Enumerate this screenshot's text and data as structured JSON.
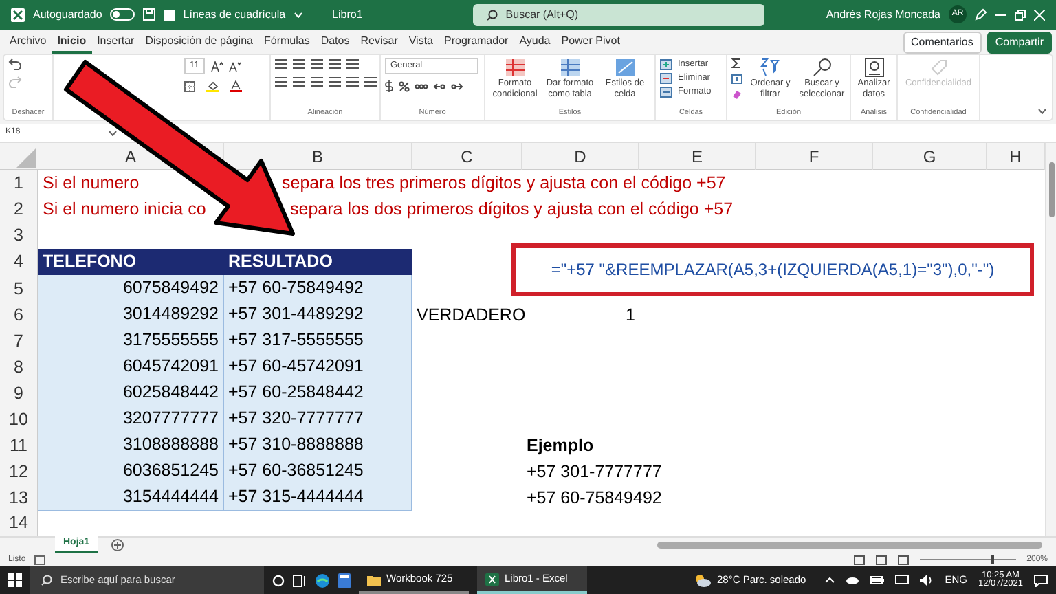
{
  "title_bar": {
    "autosave": {
      "label": "Autoguardado",
      "on": false
    },
    "gridlines": {
      "label": "Líneas de cuadrícula",
      "checked": false
    },
    "file_name": "Libro1",
    "search": {
      "placeholder": "Buscar (Alt+Q)"
    },
    "user": "Andrés Rojas Moncada",
    "avatar": "AR"
  },
  "tabs": [
    {
      "label": "Archivo",
      "selected": false
    },
    {
      "label": "Inicio",
      "selected": true
    },
    {
      "label": "Insertar",
      "selected": false
    },
    {
      "label": "Disposición de página",
      "selected": false
    },
    {
      "label": "Fórmulas",
      "selected": false
    },
    {
      "label": "Datos",
      "selected": false
    },
    {
      "label": "Revisar",
      "selected": false
    },
    {
      "label": "Vista",
      "selected": false
    },
    {
      "label": "Programador",
      "selected": false
    },
    {
      "label": "Ayuda",
      "selected": false
    },
    {
      "label": "Power Pivot",
      "selected": false
    }
  ],
  "tab_buttons": {
    "comments": "Comentarios",
    "share": "Compartir"
  },
  "ribbon": {
    "undo_label": "Deshacer",
    "font_size": "11",
    "alignment_label": "Alineación",
    "number_format": "General",
    "number_label": "Número",
    "styles": [
      {
        "label": "Formato condicional"
      },
      {
        "label": "Dar formato como tabla"
      },
      {
        "label": "Estilos de celda"
      }
    ],
    "styles_label": "Estilos",
    "cells": [
      {
        "label": "Insertar"
      },
      {
        "label": "Eliminar"
      },
      {
        "label": "Formato"
      }
    ],
    "cells_label": "Celdas",
    "editing": [
      {
        "label": "Ordenar y filtrar"
      },
      {
        "label": "Buscar y seleccionar"
      }
    ],
    "editing_label": "Edición",
    "analyze": "Analizar datos",
    "analysis_label": "Análisis",
    "confidentiality": {
      "label": "Confidencialidad",
      "disabled": true
    },
    "confidentiality_label": "Confidencialidad"
  },
  "name_box": "K18",
  "columns": [
    "A",
    "B",
    "C",
    "D",
    "E",
    "F",
    "G",
    "H"
  ],
  "rows": [
    {
      "number": "1",
      "note_start": "Si el numero",
      "note_end": "separa los tres primeros dígitos y ajusta con el código +57"
    },
    {
      "number": "2",
      "note_start": "Si el numero inicia co",
      "note_end": "separa los dos primeros dígitos y ajusta con el código +57"
    },
    {
      "number": "3"
    },
    {
      "number": "4",
      "kind": "header",
      "a": "TELEFONO",
      "b": "RESULTADO"
    },
    {
      "number": "5",
      "kind": "data",
      "a": "6075849492",
      "b": "+57 60-75849492"
    },
    {
      "number": "6",
      "kind": "data",
      "a": "3014489292",
      "b": "+57 301-4489292",
      "c": "VERDADERO",
      "value": "1"
    },
    {
      "number": "7",
      "kind": "data",
      "a": "3175555555",
      "b": "+57 317-5555555"
    },
    {
      "number": "8",
      "kind": "data",
      "a": "6045742091",
      "b": "+57 60-45742091"
    },
    {
      "number": "9",
      "kind": "data",
      "a": "6025848442",
      "b": "+57 60-25848442"
    },
    {
      "number": "10",
      "kind": "data",
      "a": "3207777777",
      "b": "+57 320-7777777"
    },
    {
      "number": "11",
      "kind": "data",
      "a": "3108888888",
      "b": "+57 310-8888888",
      "label": "Ejemplo"
    },
    {
      "number": "12",
      "kind": "data",
      "a": "6036851245",
      "b": "+57 60-36851245",
      "d": "+57 301-7777777"
    },
    {
      "number": "13",
      "kind": "data",
      "a": "3154444444",
      "b": "+57 315-4444444",
      "d": "+57 60-75849492"
    },
    {
      "number": "14"
    }
  ],
  "formula_callout": "=\"+57 \"&REEMPLAZAR(A5,3+(IZQUIERDA(A5,1)=\"3\"),0,\"-\")",
  "sheet_tabs": [
    {
      "label": "Hoja1",
      "selected": true
    }
  ],
  "status_bar": {
    "status": "Listo",
    "zoom": "200%"
  },
  "taskbar": {
    "search": {
      "placeholder": "Escribe aquí para buscar"
    },
    "apps": [
      {
        "label": "Workbook 725",
        "kind": "folder",
        "selected": false
      },
      {
        "label": "Libro1 - Excel",
        "kind": "excel",
        "selected": true
      }
    ],
    "weather": "28°C  Parc. soleado",
    "language": "ENG",
    "time": "10:25 AM",
    "date": "12/07/2021"
  }
}
